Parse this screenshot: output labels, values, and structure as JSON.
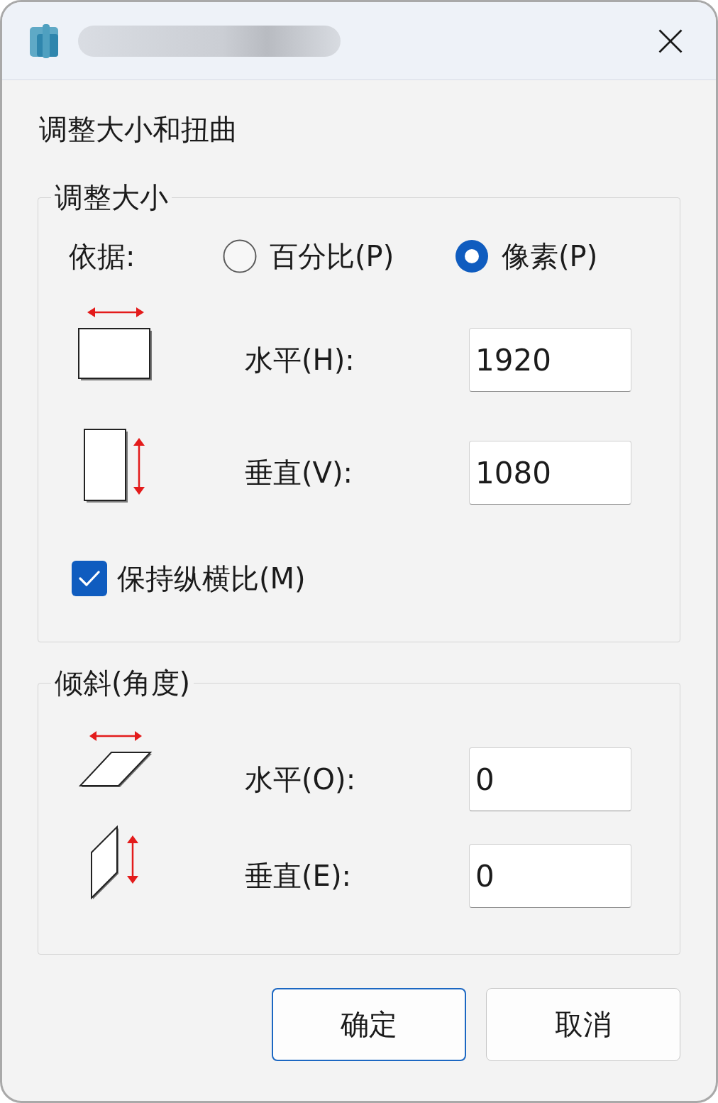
{
  "heading": "调整大小和扭曲",
  "resize": {
    "legend": "调整大小",
    "basis_label": "依据:",
    "options": [
      {
        "label": "百分比(P)",
        "selected": false
      },
      {
        "label": "像素(P)",
        "selected": true
      }
    ],
    "fields": [
      {
        "kind": "horizontal",
        "label": "水平(H):",
        "value": "1920"
      },
      {
        "kind": "vertical",
        "label": "垂直(V):",
        "value": "1080"
      }
    ],
    "keep_ratio": {
      "label": "保持纵横比(M)",
      "checked": true
    }
  },
  "skew": {
    "legend": "倾斜(角度)",
    "fields": [
      {
        "kind": "horizontal",
        "label": "水平(O):",
        "value": "0"
      },
      {
        "kind": "vertical",
        "label": "垂直(E):",
        "value": "0"
      }
    ]
  },
  "buttons": [
    {
      "label": "确定",
      "focused": true
    },
    {
      "label": "取消",
      "focused": false
    }
  ]
}
